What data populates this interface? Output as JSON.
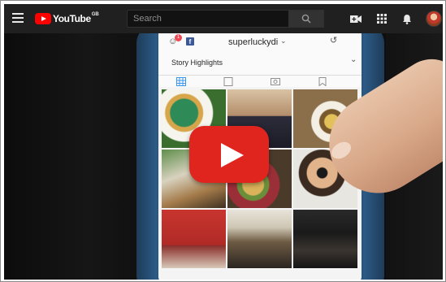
{
  "topbar": {
    "logo_text": "YouTube",
    "logo_country": "GB",
    "search": {
      "placeholder": "Search"
    },
    "icons": [
      "menu-icon",
      "search-icon",
      "video-camera-icon",
      "apps-grid-icon",
      "notifications-bell-icon"
    ]
  },
  "video": {
    "phone_screen": {
      "username": "superluckydi",
      "username_caret": "⌄",
      "notification_count": "1",
      "facebook_glyph": "f",
      "story_highlights_label": "Story Highlights"
    },
    "play_overlay": {
      "icon": "play-icon"
    }
  },
  "colors": {
    "topbar_bg": "#202020",
    "play_button": "#e0251f",
    "youtube_red": "#ff0000"
  }
}
